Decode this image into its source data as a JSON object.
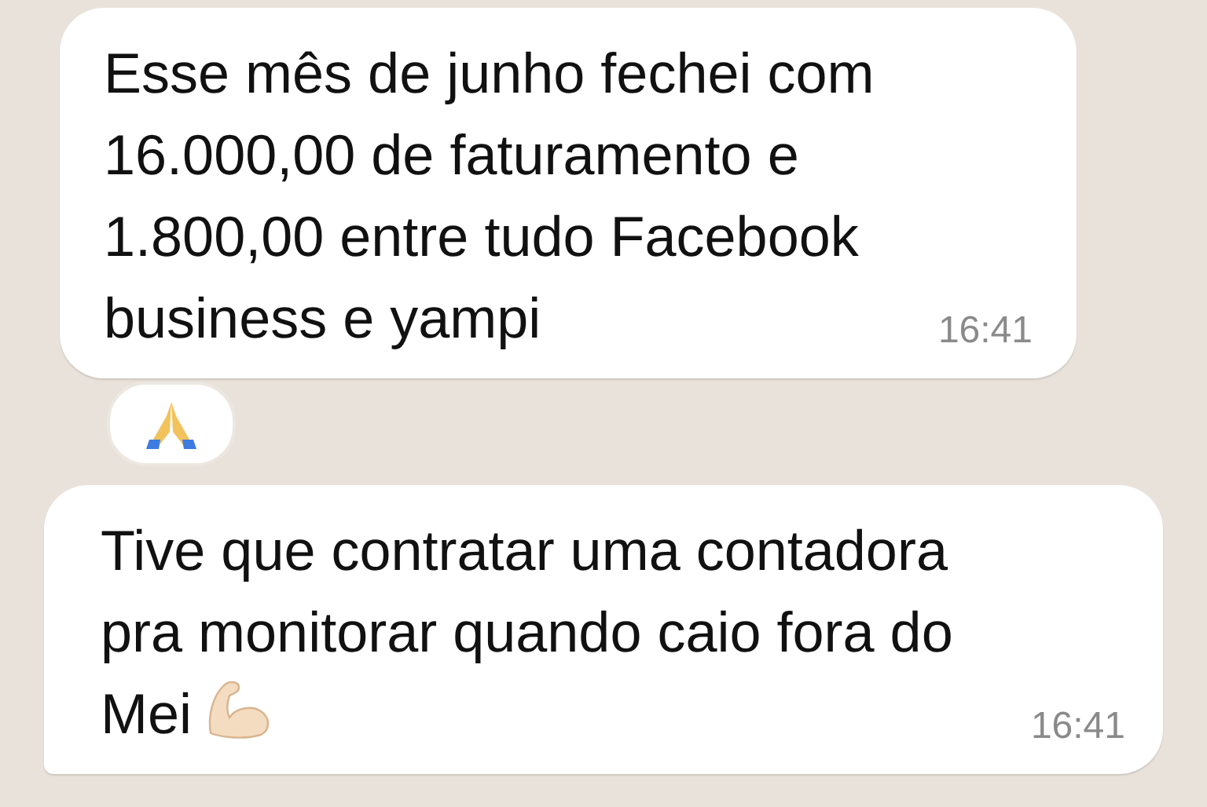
{
  "messages": [
    {
      "text": "Esse mês de junho fechei com\n16.000,00 de faturamento e\n1.800,00 entre tudo Facebook\nbusiness e yampi",
      "time": "16:41",
      "tail": false,
      "arm_emoji": false,
      "reaction": true
    },
    {
      "text": "Tive que contratar uma contadora\npra monitorar quando caio fora do\nMei",
      "time": "16:41",
      "tail": true,
      "arm_emoji": true,
      "reaction": false
    }
  ]
}
